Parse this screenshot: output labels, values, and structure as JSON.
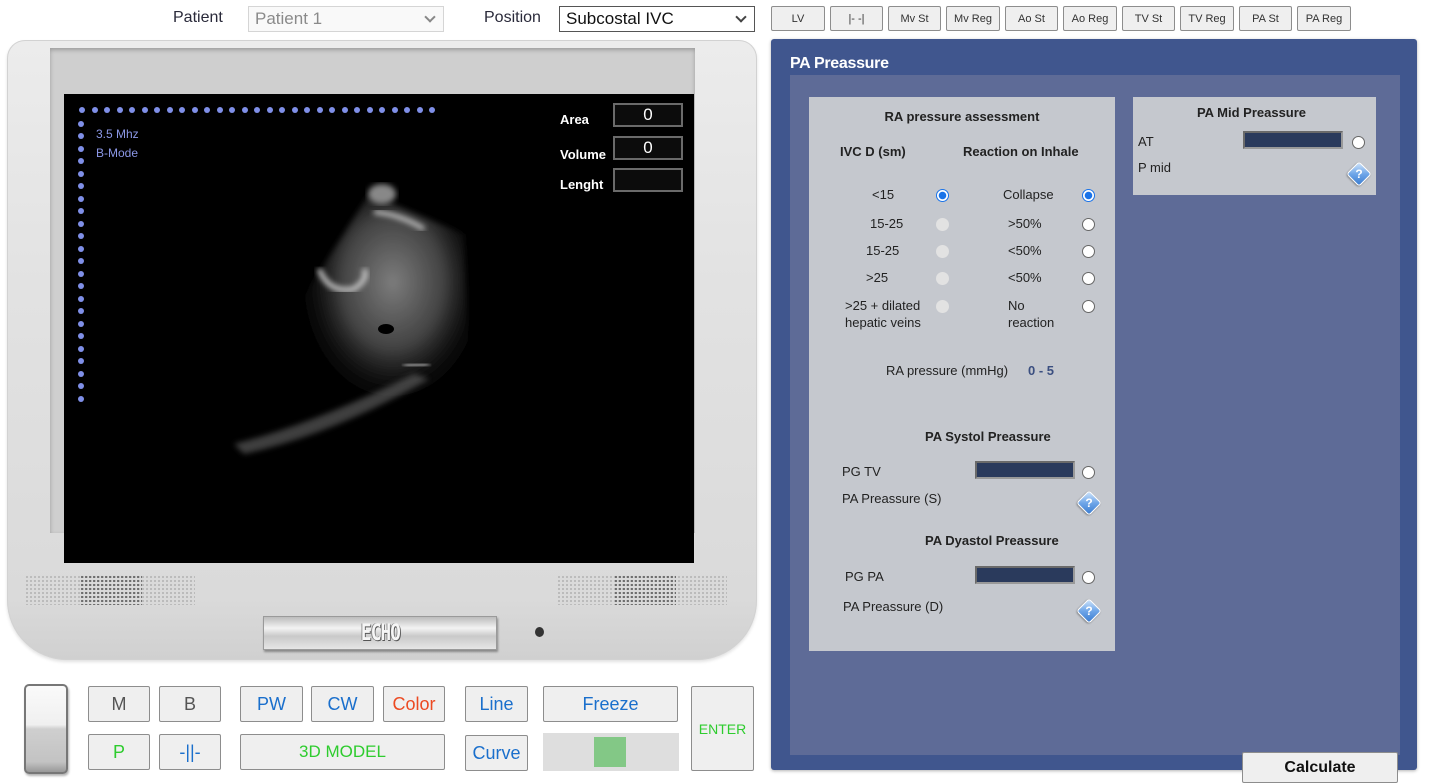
{
  "topbar": {
    "patient_label": "Patient",
    "patient_value": "Patient 1",
    "position_label": "Position",
    "position_value": "Subcostal IVC",
    "view_buttons": [
      "LV",
      "|- -|",
      "Mv St",
      "Mv Reg",
      "Ao St",
      "Ao Reg",
      "TV St",
      "TV Reg",
      "PA St",
      "PA Reg"
    ]
  },
  "monitor": {
    "frequency": "3.5 Mhz",
    "mode": "B-Mode",
    "brand": "ECHO",
    "measurements": [
      {
        "label": "Area",
        "value": "0"
      },
      {
        "label": "Volume",
        "value": "0"
      },
      {
        "label": "Lenght",
        "value": ""
      }
    ],
    "image_icon": "ultrasound-image"
  },
  "controls": {
    "m": "M",
    "b": "B",
    "pw": "PW",
    "cw": "CW",
    "color": "Color",
    "p": "P",
    "caliper": "-||-",
    "model3d": "3D MODEL",
    "line": "Line",
    "curve": "Curve",
    "freeze": "Freeze",
    "enter": "ENTER",
    "slider_value": 0.5,
    "colors": {
      "blue": "#1a6fcc",
      "red": "#ec4a22",
      "green": "#2ecc2e"
    }
  },
  "panel": {
    "title": "PA Preassure",
    "ra": {
      "title": "RA pressure assessment",
      "col1_header": "IVC D (sm)",
      "col2_header": "Reaction on Inhale",
      "rows": [
        {
          "ivc": "<15",
          "ivc_state": "checked",
          "reaction": "Collapse",
          "reaction_state": "checked"
        },
        {
          "ivc": "15-25",
          "ivc_state": "disabled",
          "reaction": ">50%",
          "reaction_state": "unchecked"
        },
        {
          "ivc": "15-25",
          "ivc_state": "disabled",
          "reaction": "<50%",
          "reaction_state": "unchecked"
        },
        {
          "ivc": ">25",
          "ivc_state": "disabled",
          "reaction": "<50%",
          "reaction_state": "unchecked"
        },
        {
          "ivc": ">25 + dilated hepatic veins",
          "ivc_line1": ">25 + dilated",
          "ivc_line2": "hepatic veins",
          "ivc_state": "disabled",
          "reaction": "No reaction",
          "reaction_line1": "No",
          "reaction_line2": "reaction",
          "reaction_state": "unchecked"
        }
      ],
      "result_label": "RA pressure (mmHg)",
      "result_value": "0 - 5"
    },
    "systol": {
      "title": "PA Systol Preassure",
      "input_label": "PG TV",
      "input_value": "",
      "output_label": "PA Preassure (S)"
    },
    "dyastol": {
      "title": "PA Dyastol Preassure",
      "input_label": "PG PA",
      "input_value": "",
      "output_label": "PA Preassure (D)"
    },
    "mid": {
      "title": "PA Mid Preassure",
      "input_label": "AT",
      "input_value": "",
      "output_label": "P mid"
    },
    "help_glyph": "?",
    "calculate_label": "Calculate",
    "colors": {
      "panel": "#40568e",
      "inner": "#5e6b97",
      "card": "#c5c8ce",
      "field": "#2a3a5c"
    }
  }
}
